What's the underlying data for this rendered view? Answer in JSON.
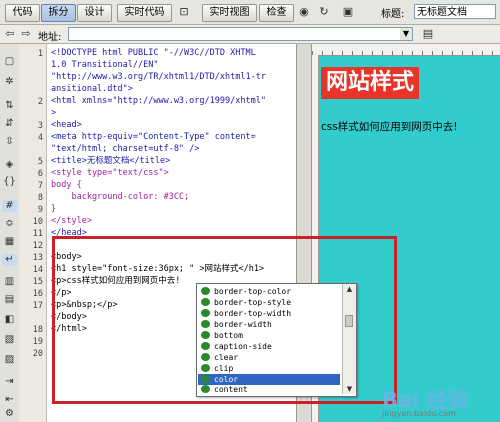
{
  "toolbar": {
    "code_label": "代码",
    "split_label": "拆分",
    "design_label": "设计",
    "live_code_label": "实时代码",
    "live_view_label": "实时视图",
    "inspect_label": "检查",
    "title_label": "标题:",
    "title_value": "无标题文档"
  },
  "addressbar": {
    "label": "地址:",
    "value": ""
  },
  "code": {
    "line_numbers": [
      "1",
      "2",
      "3",
      "4",
      "5",
      "6",
      "7",
      "8",
      "9",
      "10",
      "11",
      "12",
      "13",
      "14",
      "15",
      "16",
      "17",
      "18",
      "19",
      "20"
    ],
    "lines": [
      "<!DOCTYPE html PUBLIC \"-//W3C//DTD XHTML",
      "1.0 Transitional//EN\"",
      "\"http://www.w3.org/TR/xhtml1/DTD/xhtml1-tr",
      "ansitional.dtd\">",
      "<html xmlns=\"http://www.w3.org/1999/xhtml\"",
      ">",
      "<head>",
      "<meta http-equiv=\"Content-Type\" content=",
      "\"text/html; charset=utf-8\" />",
      "<title>无标题文档</title>",
      "<style type=\"text/css\">",
      "body {",
      "    background-color: #3CC;",
      "}",
      "</style>",
      "</head>",
      "",
      "<body>",
      "<h1 style=\"font-size:36px; \" >网站样式</h1>",
      "<p>css样式如何应用到网页中去!",
      "</p>",
      "<p>&nbsp;</p>",
      "</body>",
      "</html>"
    ]
  },
  "autocomplete": {
    "items": [
      "border-top-color",
      "border-top-style",
      "border-top-width",
      "border-width",
      "bottom",
      "caption-side",
      "clear",
      "clip",
      "color",
      "content"
    ],
    "selected": "color"
  },
  "design": {
    "heading": "网站样式",
    "paragraph": "css样式如何应用到网页中去!",
    "background": "#33cccc"
  },
  "watermark": {
    "text": "Bai 经验",
    "url": "jingyan.baidu.com"
  }
}
